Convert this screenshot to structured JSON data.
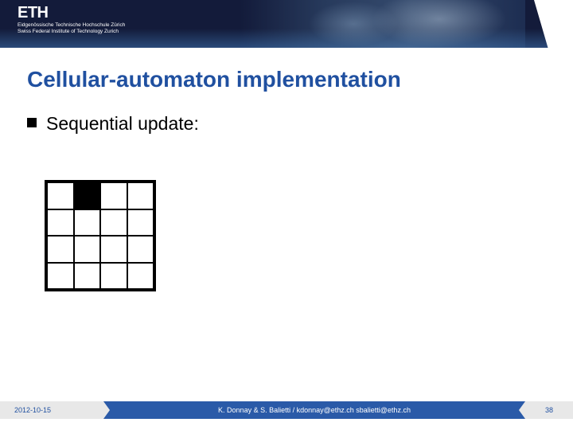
{
  "header": {
    "logo_main": "ETH",
    "logo_sub": "Eidgenössische Technische Hochschule Zürich\nSwiss Federal Institute of Technology Zurich"
  },
  "slide": {
    "title": "Cellular-automaton implementation",
    "bullet": "Sequential update:",
    "grid": {
      "rows": 4,
      "cols": 4,
      "filled": [
        [
          0,
          1
        ]
      ]
    }
  },
  "footer": {
    "date": "2012-10-15",
    "authors": "K. Donnay & S. Balietti / kdonnay@ethz.ch   sbalietti@ethz.ch",
    "page": "38"
  }
}
